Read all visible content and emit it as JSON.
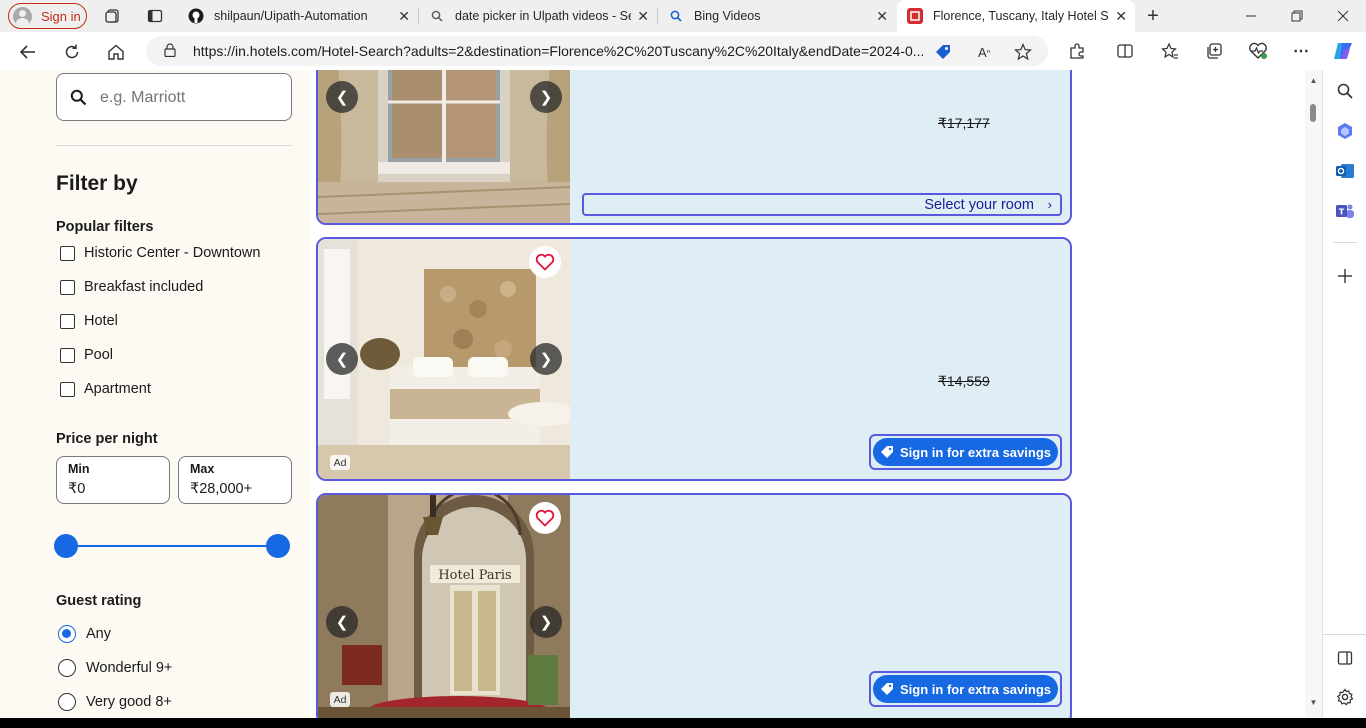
{
  "browser": {
    "profile_label": "Sign in",
    "tabs": [
      {
        "title": "shilpaun/Uipath-Automation",
        "icon": "github-icon"
      },
      {
        "title": "date picker in Ulpath videos - Se",
        "icon": "search-icon"
      },
      {
        "title": "Bing Videos",
        "icon": "search-icon"
      },
      {
        "title": "Florence, Tuscany, Italy Hotel Sea",
        "icon": "hotels-icon",
        "active": true
      }
    ],
    "new_tab_label": "+",
    "url": "https://in.hotels.com/Hotel-Search?adults=2&destination=Florence%2C%20Tuscany%2C%20Italy&endDate=2024-0..."
  },
  "filters": {
    "search_placeholder": "e.g. Marriott",
    "heading": "Filter by",
    "popular": {
      "title": "Popular filters",
      "items": [
        "Historic Center - Downtown",
        "Breakfast included",
        "Hotel",
        "Pool",
        "Apartment"
      ]
    },
    "price": {
      "title": "Price per night",
      "min_label": "Min",
      "min_value": "₹0",
      "max_label": "Max",
      "max_value": "₹28,000+",
      "range_fraction": [
        0.0,
        1.0
      ]
    },
    "guest_rating": {
      "title": "Guest rating",
      "options": [
        "Any",
        "Wonderful 9+",
        "Very good 8+"
      ],
      "selected": "Any"
    }
  },
  "results": [
    {
      "price": "₹17,177",
      "cta": "Select your room",
      "ad": false
    },
    {
      "price": "₹14,559",
      "cta": "Sign in for extra savings",
      "ad_label": "Ad"
    },
    {
      "cta": "Sign in for extra savings",
      "ad_label": "Ad",
      "sign_text": "Hotel Paris"
    }
  ],
  "colors": {
    "accent": "#1668e3",
    "card_border": "#5a5ae0",
    "card_bg": "#dfeef5",
    "filter_bg": "#fdfaf4",
    "heart": "#e3143c"
  }
}
